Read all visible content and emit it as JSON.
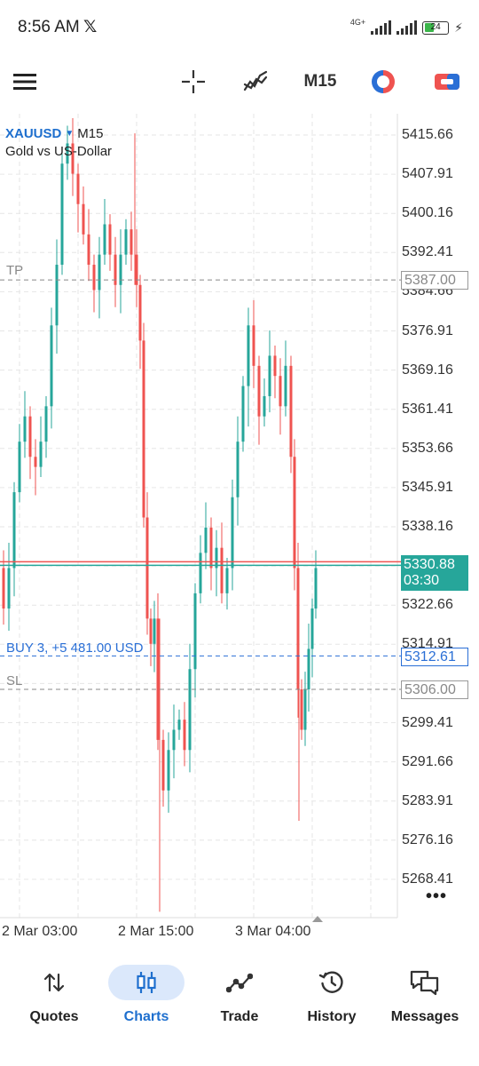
{
  "status_bar": {
    "time": "8:56 AM",
    "x_icon": "𝕏",
    "network": "4G+",
    "battery": "24",
    "bolt": "⚡"
  },
  "toolbar": {
    "timeframe": "M15"
  },
  "chart": {
    "symbol": "XAUUSD",
    "timeframe": "M15",
    "description": "Gold vs US-Dollar",
    "price_ticks": [
      "5415.66",
      "5407.91",
      "5400.16",
      "5392.41",
      "5384.66",
      "5376.91",
      "5369.16",
      "5361.41",
      "5353.66",
      "5345.91",
      "5338.16",
      "5322.66",
      "5314.91",
      "5299.41",
      "5291.66",
      "5283.91",
      "5276.16",
      "5268.41"
    ],
    "time_ticks": [
      "2 Mar 03:00",
      "2 Mar 15:00",
      "3 Mar 04:00"
    ],
    "tp": {
      "label": "TP",
      "price": "5387.00"
    },
    "sl": {
      "label": "SL",
      "price": "5306.00"
    },
    "position": {
      "label": "BUY 3,  +5 481.00 USD",
      "price": "5312.61"
    },
    "current": {
      "price": "5330.88",
      "countdown": "03:30"
    },
    "more": "•••",
    "colors": {
      "bull": "#26a69a",
      "bear": "#ef5350",
      "tp_sl": "#888888",
      "buy": "#2a6fd6"
    }
  },
  "nav": {
    "items": [
      {
        "label": "Quotes",
        "icon": "quotes-arrows-icon"
      },
      {
        "label": "Charts",
        "icon": "candlestick-icon",
        "active": true
      },
      {
        "label": "Trade",
        "icon": "trade-line-icon"
      },
      {
        "label": "History",
        "icon": "history-clock-icon"
      },
      {
        "label": "Messages",
        "icon": "messages-chat-icon"
      }
    ]
  }
}
